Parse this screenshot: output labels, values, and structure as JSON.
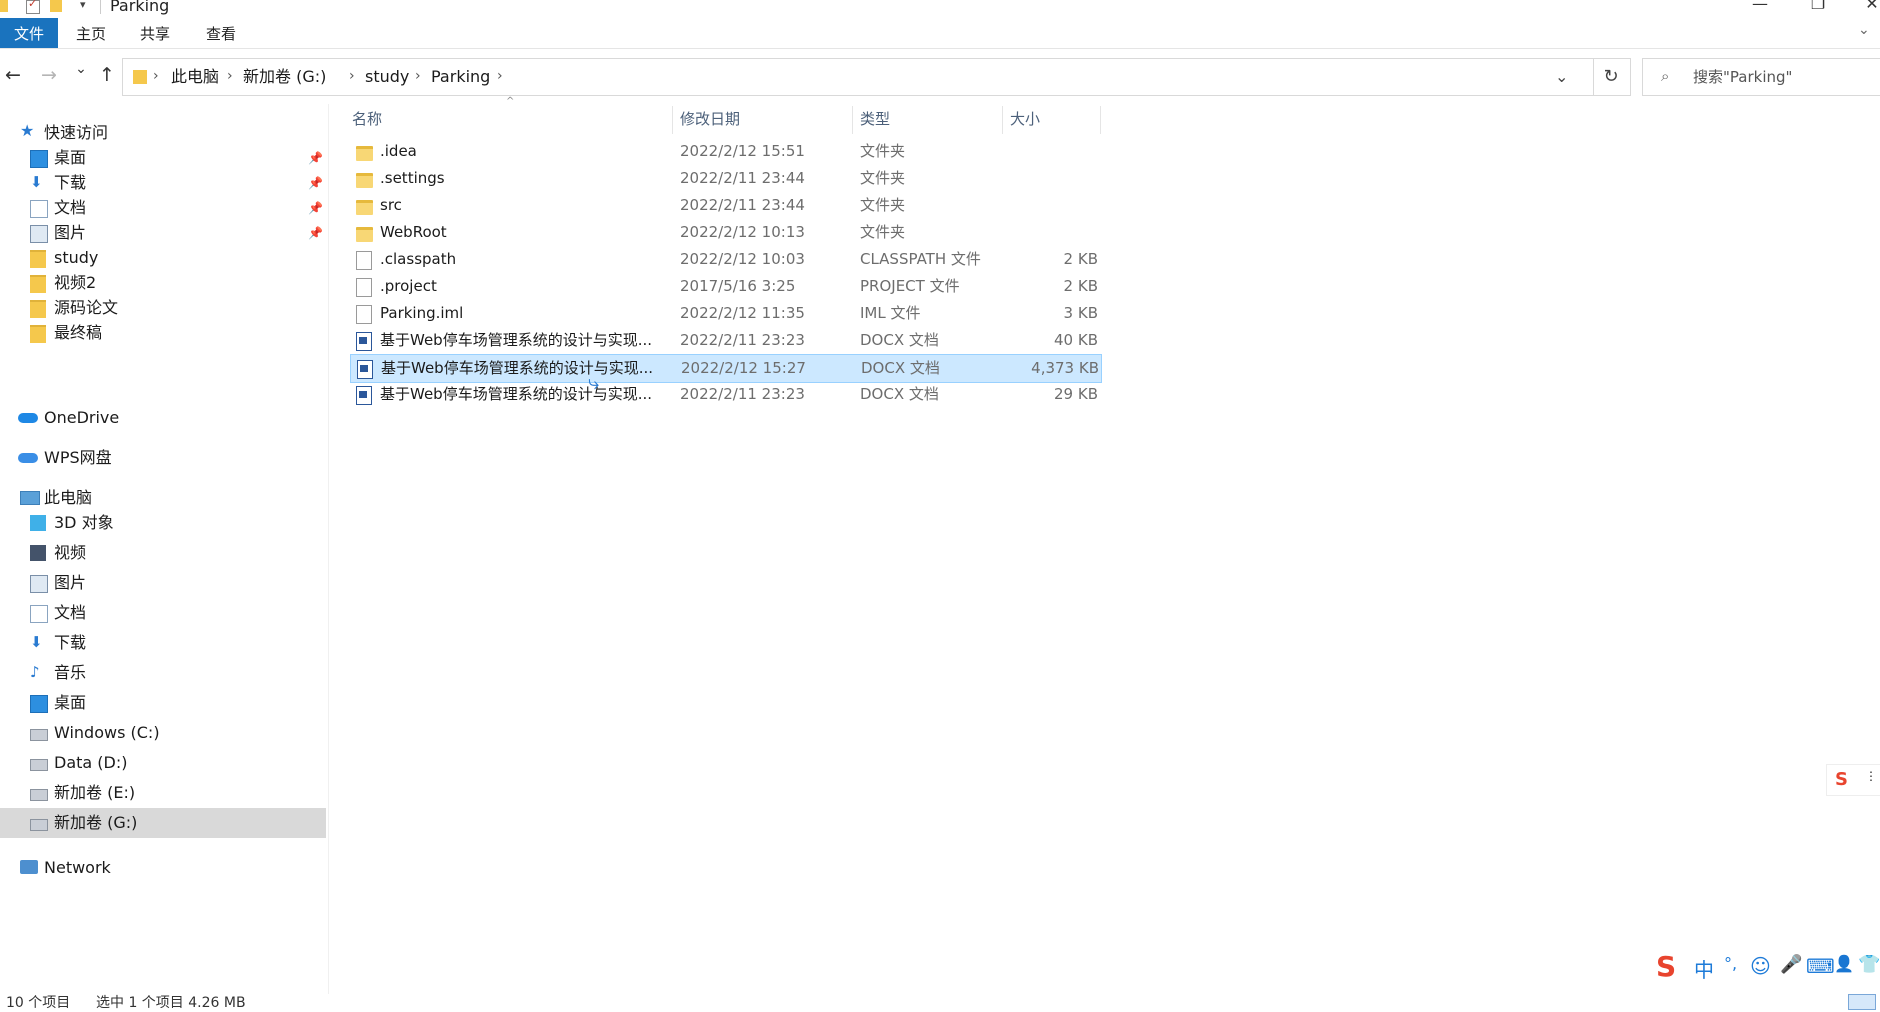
{
  "window": {
    "title": "Parking",
    "minimize": "—",
    "restore": "❐",
    "close": "✕"
  },
  "ribbon": {
    "tabs": [
      "文件",
      "主页",
      "共享",
      "查看"
    ]
  },
  "nav": {
    "back": "←",
    "forward": "→",
    "recent": "⌄",
    "up": "↑",
    "breadcrumbs": [
      "此电脑",
      "新加卷 (G:)",
      "study",
      "Parking"
    ],
    "dropdown": "⌄",
    "refresh": "↻",
    "search_placeholder": "搜索\"Parking\""
  },
  "sidebar": {
    "quick_access": "快速访问",
    "quick_items": [
      {
        "label": "桌面",
        "icon": "desktop-icon",
        "pinned": true
      },
      {
        "label": "下载",
        "icon": "download-icon",
        "pinned": true
      },
      {
        "label": "文档",
        "icon": "documents-icon",
        "pinned": true
      },
      {
        "label": "图片",
        "icon": "pictures-icon",
        "pinned": true
      },
      {
        "label": "study",
        "icon": "folder-icon",
        "pinned": false
      },
      {
        "label": "视频2",
        "icon": "folder-icon",
        "pinned": false
      },
      {
        "label": "源码论文",
        "icon": "folder-icon",
        "pinned": false
      },
      {
        "label": "最终稿",
        "icon": "folder-icon",
        "pinned": false
      }
    ],
    "onedrive": "OneDrive",
    "wps": "WPS网盘",
    "this_pc": "此电脑",
    "pc_items": [
      {
        "label": "3D 对象",
        "icon": "3d-objects-icon"
      },
      {
        "label": "视频",
        "icon": "videos-icon"
      },
      {
        "label": "图片",
        "icon": "pictures-icon"
      },
      {
        "label": "文档",
        "icon": "documents-icon"
      },
      {
        "label": "下载",
        "icon": "download-icon"
      },
      {
        "label": "音乐",
        "icon": "music-icon"
      },
      {
        "label": "桌面",
        "icon": "desktop-icon"
      },
      {
        "label": "Windows (C:)",
        "icon": "drive-icon"
      },
      {
        "label": "Data (D:)",
        "icon": "drive-icon"
      },
      {
        "label": "新加卷 (E:)",
        "icon": "drive-icon"
      },
      {
        "label": "新加卷 (G:)",
        "icon": "drive-icon",
        "selected": true
      }
    ],
    "network": "Network"
  },
  "columns": [
    "名称",
    "修改日期",
    "类型",
    "大小"
  ],
  "files": [
    {
      "name": ".idea",
      "date": "2022/2/12 15:51",
      "type": "文件夹",
      "size": "",
      "kind": "folder"
    },
    {
      "name": ".settings",
      "date": "2022/2/11 23:44",
      "type": "文件夹",
      "size": "",
      "kind": "folder"
    },
    {
      "name": "src",
      "date": "2022/2/11 23:44",
      "type": "文件夹",
      "size": "",
      "kind": "folder"
    },
    {
      "name": "WebRoot",
      "date": "2022/2/12 10:13",
      "type": "文件夹",
      "size": "",
      "kind": "folder"
    },
    {
      "name": ".classpath",
      "date": "2022/2/12 10:03",
      "type": "CLASSPATH 文件",
      "size": "2 KB",
      "kind": "file"
    },
    {
      "name": ".project",
      "date": "2017/5/16 3:25",
      "type": "PROJECT 文件",
      "size": "2 KB",
      "kind": "file"
    },
    {
      "name": "Parking.iml",
      "date": "2022/2/12 11:35",
      "type": "IML 文件",
      "size": "3 KB",
      "kind": "file"
    },
    {
      "name": "基于Web停车场管理系统的设计与实现...",
      "date": "2022/2/11 23:23",
      "type": "DOCX 文档",
      "size": "40 KB",
      "kind": "docx"
    },
    {
      "name": "基于Web停车场管理系统的设计与实现...",
      "date": "2022/2/12 15:27",
      "type": "DOCX 文档",
      "size": "4,373 KB",
      "kind": "docx",
      "selected": true
    },
    {
      "name": "基于Web停车场管理系统的设计与实现...",
      "date": "2022/2/11 23:23",
      "type": "DOCX 文档",
      "size": "29 KB",
      "kind": "docx"
    }
  ],
  "status": {
    "count": "10 个项目",
    "selection": "选中 1 个项目 4.26 MB"
  },
  "ime": {
    "logo": "S",
    "mode": "中",
    "punct": "°,",
    "emoji": "☺",
    "mic": "🎤",
    "keyboard": "⌨",
    "user": "👤",
    "skin": "👕"
  }
}
